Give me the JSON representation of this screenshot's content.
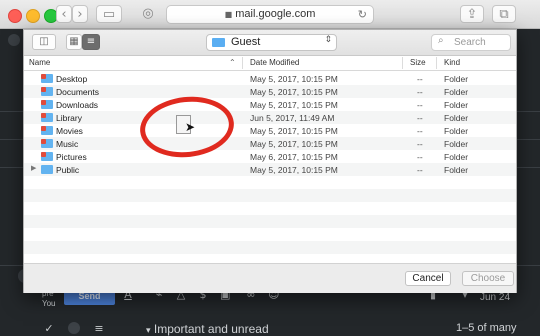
{
  "browser": {
    "address": "mail.google.com"
  },
  "gmail": {
    "partial_name": "pre",
    "partial_you": "You",
    "send_label": "Send",
    "date_right": "Jun 24",
    "important_label": "Important and unread",
    "count_label": "1–5 of many"
  },
  "dialog": {
    "location": "Guest",
    "search_placeholder": "Search",
    "columns": {
      "name": "Name",
      "date": "Date Modified",
      "size": "Size",
      "kind": "Kind"
    },
    "rows": [
      {
        "name": "Desktop",
        "date": "May 5, 2017, 10:15 PM",
        "size": "--",
        "kind": "Folder"
      },
      {
        "name": "Documents",
        "date": "May 5, 2017, 10:15 PM",
        "size": "--",
        "kind": "Folder"
      },
      {
        "name": "Downloads",
        "date": "May 5, 2017, 10:15 PM",
        "size": "--",
        "kind": "Folder"
      },
      {
        "name": "Library",
        "date": "Jun 5, 2017, 11:49 AM",
        "size": "--",
        "kind": "Folder"
      },
      {
        "name": "Movies",
        "date": "May 5, 2017, 10:15 PM",
        "size": "--",
        "kind": "Folder"
      },
      {
        "name": "Music",
        "date": "May 5, 2017, 10:15 PM",
        "size": "--",
        "kind": "Folder"
      },
      {
        "name": "Pictures",
        "date": "May 6, 2017, 10:15 PM",
        "size": "--",
        "kind": "Folder"
      },
      {
        "name": "Public",
        "date": "May 5, 2017, 10:15 PM",
        "size": "--",
        "kind": "Folder"
      }
    ],
    "cancel_label": "Cancel",
    "choose_label": "Choose"
  }
}
